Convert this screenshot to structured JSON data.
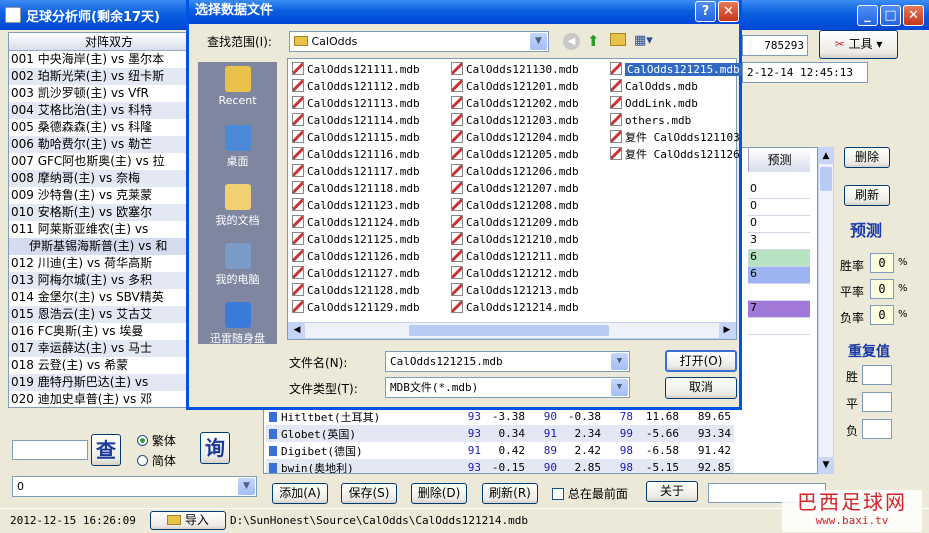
{
  "app": {
    "title": "足球分析师(剩余17天)",
    "id_field": "785293",
    "datetime_field": "2-12-14 12:45:13",
    "tools_label": "工具",
    "column_header": "对阵双方",
    "predict_col": "预测",
    "matches": [
      "001 中央海岸(主) vs 墨尔本",
      "002 珀斯光荣(主) vs 纽卡斯",
      "003 凯沙罗顿(主) vs VfR",
      "004 艾格比治(主) vs 科特",
      "005 桑德森森(主) vs 科隆",
      "006 勒哈费尔(主) vs 勒芒",
      "007 GFC阿也斯奥(主) vs 拉",
      "008 摩纳哥(主) vs 奈梅",
      "009 沙特鲁(主) vs 克莱蒙",
      "010 安格斯(主) vs 欧塞尔",
      "011 阿莱斯亚维农(主) vs",
      "  伊斯基锡海斯普(主) vs 和",
      "012 川迪(主) vs 荷华高斯",
      "013 阿梅尔城(主) vs 多积",
      "014 金堡尔(主) vs SBV精英",
      "015 恩浩云(主) vs 艾古艾",
      "016 FC奥斯(主) vs 埃曼",
      "017 幸运薛达(主) vs 马士",
      "018 云登(主) vs 希蒙",
      "019 鹿特丹斯巴达(主) vs",
      "020 迪加史卓普(主) vs 邓",
      "021 拜仁慕尼黑(主) vs 慕"
    ],
    "search_btn1": "查",
    "search_btn2": "询",
    "radio_trad": "繁体",
    "radio_simp": "简体",
    "bottom_select": "0",
    "footer_datetime": "2012-12-15 16:26:09",
    "import_btn": "导入",
    "footer_path": "D:\\SunHonest\\Source\\CalOdds\\CalOdds121214.mdb",
    "right_panel": {
      "delete_btn": "删除",
      "refresh_btn": "刷新",
      "predict_title": "预测",
      "win_label": "胜率",
      "draw_label": "平率",
      "lose_label": "负率",
      "win_val": "0",
      "draw_val": "0",
      "lose_val": "0",
      "pct": "%",
      "repeat_title": "重复值",
      "r_win": "胜",
      "r_draw": "平",
      "r_lose": "负"
    },
    "predict_vals": [
      "0",
      "0",
      "0",
      "3",
      "6",
      "6",
      "",
      "7",
      ""
    ],
    "odds_rows": [
      {
        "name": "Hitltbet(土耳其)",
        "a": "93",
        "b": "-3.38",
        "c": "90",
        "d": "-0.38",
        "e": "78",
        "f": "11.68",
        "g": "89.65"
      },
      {
        "name": "Globet(英国)",
        "a": "93",
        "b": "0.34",
        "c": "91",
        "d": "2.34",
        "e": "99",
        "f": "-5.66",
        "g": "93.34"
      },
      {
        "name": "Digibet(德国)",
        "a": "91",
        "b": "0.42",
        "c": "89",
        "d": "2.42",
        "e": "98",
        "f": "-6.58",
        "g": "91.42"
      },
      {
        "name": "bwin(奥地利)",
        "a": "93",
        "b": "-0.15",
        "c": "90",
        "d": "2.85",
        "e": "98",
        "f": "-5.15",
        "g": "92.85"
      }
    ],
    "bottom_buttons": {
      "add": "添加(A)",
      "save": "保存(S)",
      "del": "删除(D)",
      "refresh": "刷新(R)",
      "always_top": "总在最前面",
      "about": "关于"
    },
    "watermark_line1": "巴西足球网",
    "watermark_line2": "www.baxi.tv"
  },
  "dialog": {
    "title": "选择数据文件",
    "lookin_label": "查找范围(I):",
    "lookin_value": "CalOdds",
    "places": [
      "Recent",
      "桌面",
      "我的文档",
      "我的电脑",
      "迅雷随身盘"
    ],
    "files_col1": [
      "CalOdds121111.mdb",
      "CalOdds121112.mdb",
      "CalOdds121113.mdb",
      "CalOdds121114.mdb",
      "CalOdds121115.mdb",
      "CalOdds121116.mdb",
      "CalOdds121117.mdb",
      "CalOdds121118.mdb",
      "CalOdds121123.mdb",
      "CalOdds121124.mdb",
      "CalOdds121125.mdb",
      "CalOdds121126.mdb",
      "CalOdds121127.mdb",
      "CalOdds121128.mdb",
      "CalOdds121129.mdb"
    ],
    "files_col2": [
      "CalOdds121130.mdb",
      "CalOdds121201.mdb",
      "CalOdds121202.mdb",
      "CalOdds121203.mdb",
      "CalOdds121204.mdb",
      "CalOdds121205.mdb",
      "CalOdds121206.mdb",
      "CalOdds121207.mdb",
      "CalOdds121208.mdb",
      "CalOdds121209.mdb",
      "CalOdds121210.mdb",
      "CalOdds121211.mdb",
      "CalOdds121212.mdb",
      "CalOdds121213.mdb",
      "CalOdds121214.mdb"
    ],
    "files_col3": [
      "CalOdds121215.mdb",
      "CalOdds.mdb",
      "OddLink.mdb",
      "others.mdb",
      "复件 CalOdds121103",
      "复件 CalOdds121126"
    ],
    "filename_label": "文件名(N):",
    "filename_value": "CalOdds121215.mdb",
    "filetype_label": "文件类型(T):",
    "filetype_value": "MDB文件(*.mdb)",
    "open_btn": "打开(O)",
    "cancel_btn": "取消"
  }
}
